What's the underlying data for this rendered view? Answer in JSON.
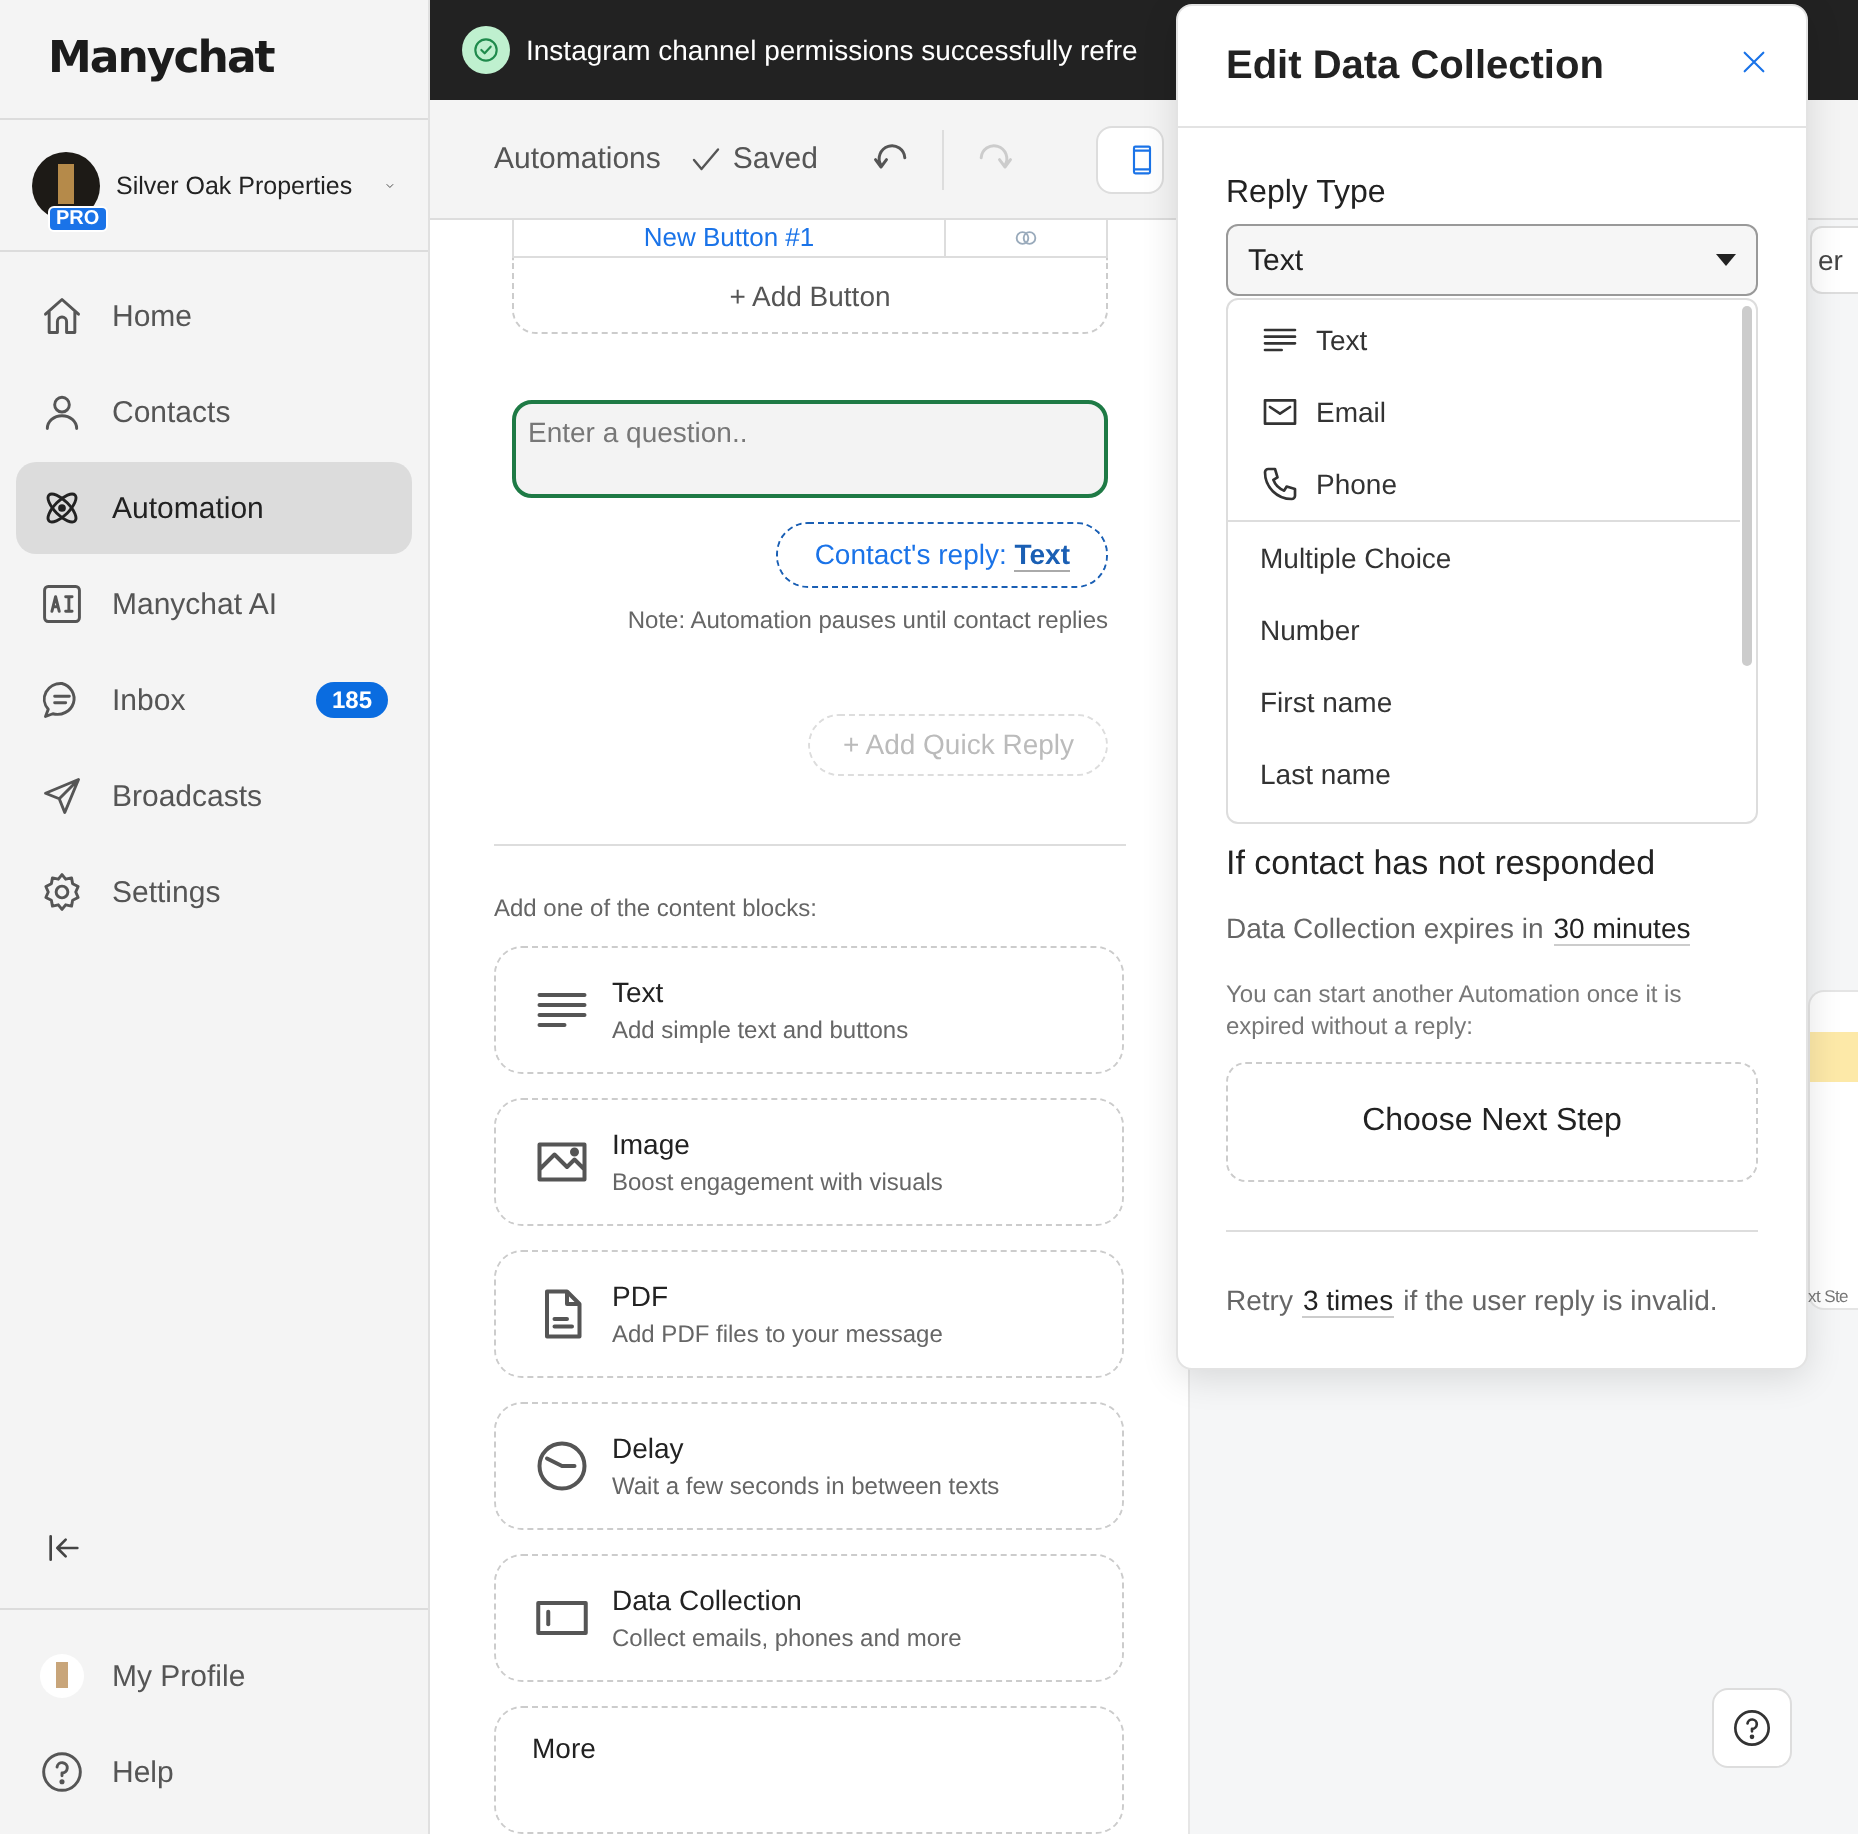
{
  "sidebar": {
    "logo": "Manychat",
    "account": {
      "name": "Silver Oak Properties",
      "badge": "PRO"
    },
    "nav": [
      {
        "label": "Home",
        "kind": "home",
        "selected": false
      },
      {
        "label": "Contacts",
        "kind": "person",
        "selected": false
      },
      {
        "label": "Automation",
        "kind": "atom",
        "selected": true
      },
      {
        "label": "Manychat AI",
        "kind": "ai",
        "selected": false
      },
      {
        "label": "Inbox",
        "kind": "chat",
        "selected": false,
        "badge": "185"
      },
      {
        "label": "Broadcasts",
        "kind": "send",
        "selected": false
      },
      {
        "label": "Settings",
        "kind": "gear",
        "selected": false
      }
    ],
    "footer": [
      {
        "label": "My Profile",
        "kind": "avatar"
      },
      {
        "label": "Help",
        "kind": "help"
      }
    ]
  },
  "toast": {
    "message": "Instagram channel permissions successfully refre"
  },
  "toolbar": {
    "breadcrumb": "Automations",
    "status": "Saved"
  },
  "editor": {
    "button_row": {
      "label": "New Button #1"
    },
    "add_button": "+ Add Button",
    "question": {
      "placeholder": "Enter a question.."
    },
    "reply_chip": "Contact's reply: **Text**",
    "note": "Note: Automation pauses until contact replies",
    "add_quick_reply": {
      "label": "+ Add Quick Reply",
      "disabled": true
    },
    "blocks_heading": "Add one of the content blocks:",
    "blocks": [
      {
        "title": "Text",
        "subtitle": "Add simple text and buttons",
        "kind": "lines"
      },
      {
        "title": "Image",
        "subtitle": "Boost engagement with visuals",
        "kind": "image"
      },
      {
        "title": "PDF",
        "subtitle": "Add PDF files to your message",
        "kind": "document"
      },
      {
        "title": "Delay",
        "subtitle": "Wait a few seconds in between texts",
        "kind": "clock"
      },
      {
        "title": "Data Collection",
        "subtitle": "Collect emails, phones and more",
        "kind": "input"
      },
      {
        "title": "More"
      }
    ]
  },
  "canvas": {
    "button_fragment": "er",
    "footer_fragment": "xt Ste"
  },
  "panel": {
    "title": "Edit Data Collection",
    "reply_type_label": "Reply Type",
    "reply_type_value": "Text",
    "options": [
      {
        "label": "Text",
        "kind": "lines"
      },
      {
        "label": "Email",
        "kind": "envelope"
      },
      {
        "label": "Phone",
        "kind": "phone"
      },
      {
        "label": "Multiple Choice"
      },
      {
        "label": "Number"
      },
      {
        "label": "First name"
      },
      {
        "label": "Last name"
      }
    ],
    "no_response_heading": "If contact has not responded",
    "expiry_prefix": "Data Collection expires in",
    "expiry_value": "30 minutes",
    "expiry_note": "You can start another Automation once it is expired without a reply:",
    "next_step": "Choose Next Step",
    "retry_prefix": "Retry",
    "retry_value": "3 times",
    "retry_suffix": "if the user reply is invalid."
  }
}
